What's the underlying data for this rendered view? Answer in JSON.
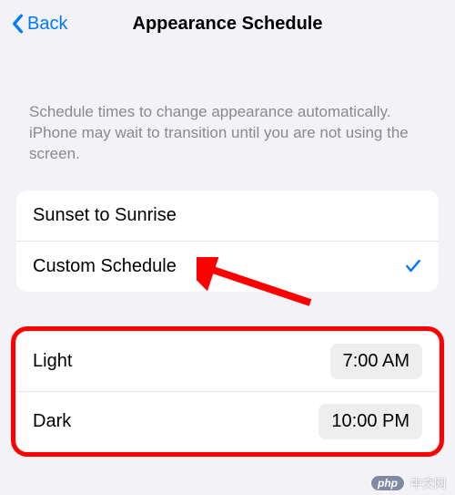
{
  "nav": {
    "back_label": "Back",
    "title": "Appearance Schedule"
  },
  "description": "Schedule times to change appearance automatically. iPhone may wait to transition until you are not using the screen.",
  "schedule_options": {
    "sunset_sunrise": "Sunset to Sunrise",
    "custom": "Custom Schedule",
    "selected": "custom"
  },
  "times": {
    "light_label": "Light",
    "light_value": "7:00 AM",
    "dark_label": "Dark",
    "dark_value": "10:00 PM"
  },
  "watermark": {
    "badge": "php",
    "text": "中文网"
  }
}
